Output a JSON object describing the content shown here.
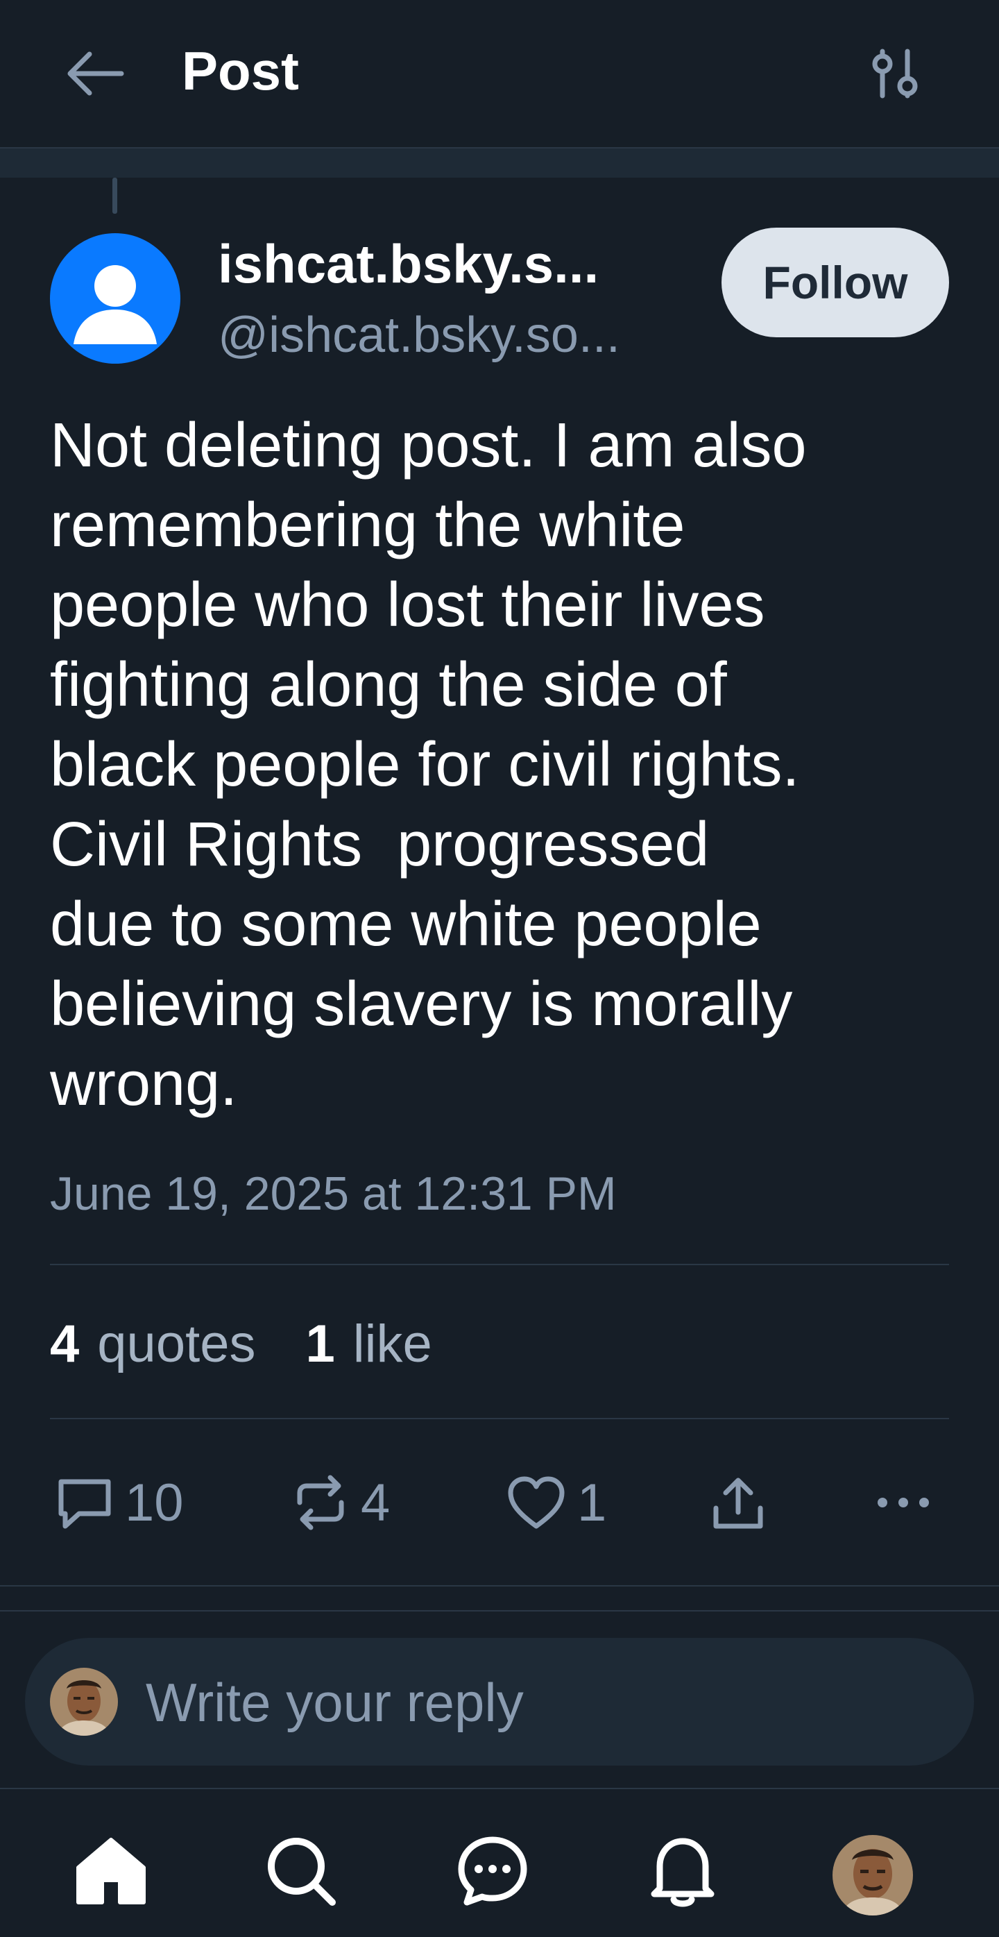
{
  "header": {
    "title": "Post",
    "back_icon": "arrow-left-icon",
    "filter_icon": "sliders-icon"
  },
  "author": {
    "display_name": "ishcat.bsky.s...",
    "handle": "@ishcat.bsky.so...",
    "follow_label": "Follow"
  },
  "post": {
    "lines": [
      "Not deleting post. I am also",
      "remembering the white",
      "people who lost their lives",
      "fighting along the side of",
      "black people for civil rights.",
      "Civil Rights  progressed",
      "due to some white people",
      "believing slavery is morally",
      "wrong."
    ],
    "timestamp": "June 19, 2025 at 12:31 PM"
  },
  "stats": {
    "quotes_count": "4",
    "quotes_label": "quotes",
    "likes_count": "1",
    "likes_label": "like"
  },
  "actions": {
    "reply_count": "10",
    "repost_count": "4",
    "like_count": "1"
  },
  "reply_composer": {
    "placeholder": "Write your reply"
  },
  "tabbar": {
    "items": [
      "home-icon",
      "search-icon",
      "chat-icon",
      "notifications-icon",
      "profile-avatar"
    ]
  },
  "colors": {
    "background": "#161e27",
    "accent": "#0a7aff",
    "muted_text": "#8a9bb0",
    "follow_bg": "#dde4ec"
  }
}
